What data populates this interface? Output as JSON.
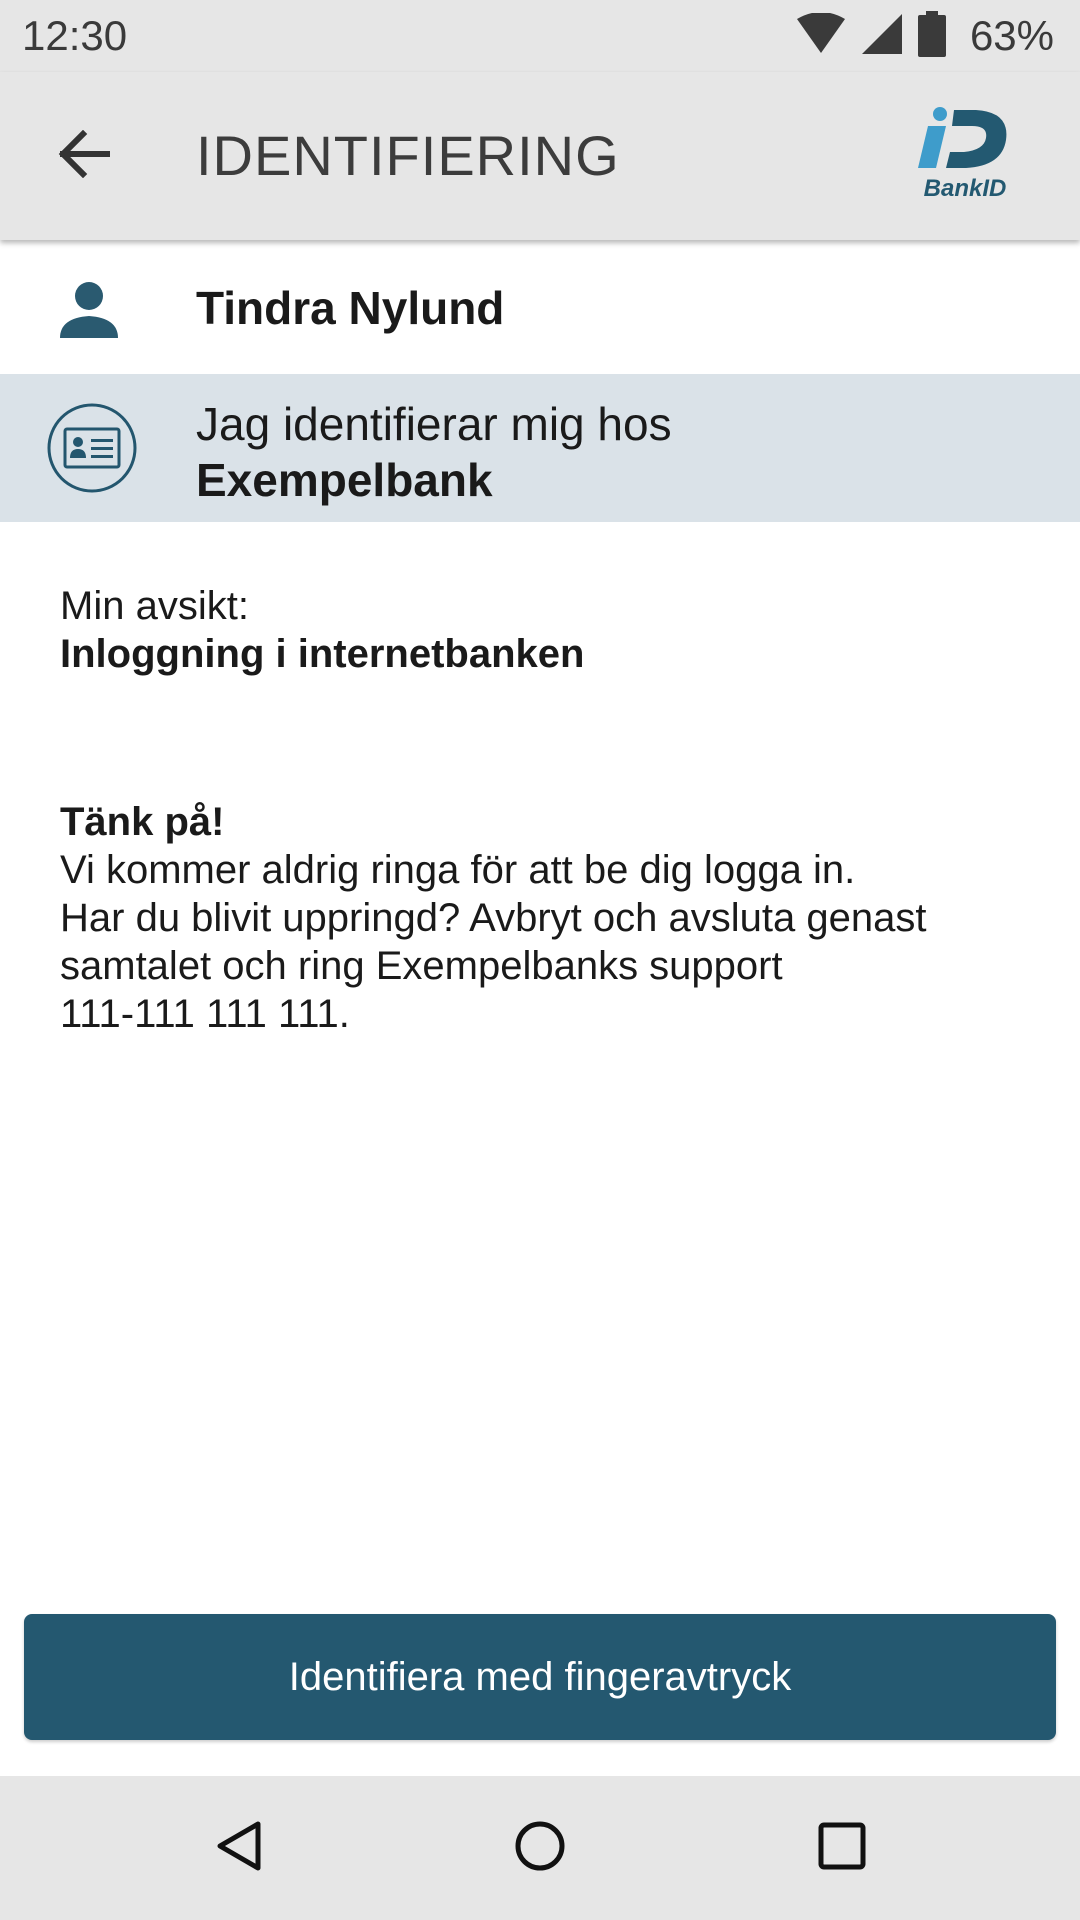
{
  "status_bar": {
    "time": "12:30",
    "battery_percent": "63%",
    "icons": [
      "wifi-icon",
      "cellular-signal-icon",
      "battery-icon"
    ]
  },
  "app_bar": {
    "title": "IDENTIFIERING",
    "back_icon": "arrow-back-icon",
    "logo_text": "BankID"
  },
  "user": {
    "icon": "person-icon",
    "name": "Tindra Nylund"
  },
  "relying_party": {
    "icon": "id-card-icon",
    "prefix": "Jag identifierar mig hos",
    "name": "Exempelbank"
  },
  "intent": {
    "label": "Min avsikt:",
    "value": "Inloggning i internetbanken"
  },
  "notice": {
    "heading": "Tänk på!",
    "lines": [
      "Vi kommer aldrig ringa för att be dig logga in.",
      "Har du blivit uppringd? Avbryt och avsluta genast",
      "samtalet och ring Exempelbanks support",
      "111-111 111 111."
    ]
  },
  "primary_button": {
    "label": "Identifiera med fingeravtryck"
  },
  "nav_bar": {
    "icons": [
      "nav-back-icon",
      "nav-home-icon",
      "nav-recents-icon"
    ]
  },
  "colors": {
    "bars": "#e6e6e6",
    "highlight_row": "#dae2e8",
    "accent": "#245870",
    "logo_blue": "#3e9ccb",
    "logo_dark": "#235971"
  }
}
